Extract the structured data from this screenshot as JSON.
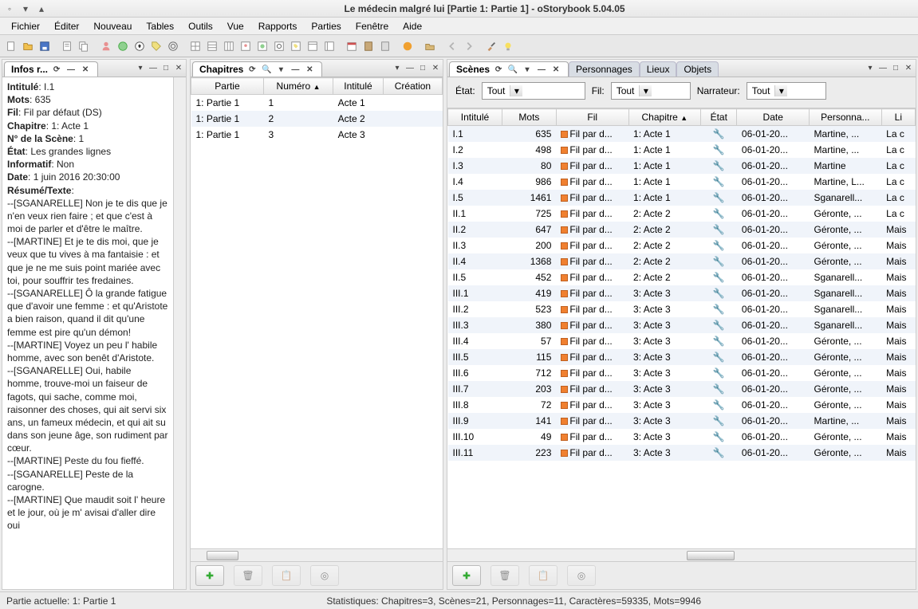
{
  "window": {
    "title": "Le médecin malgré lui [Partie 1: Partie 1] - oStorybook 5.04.05"
  },
  "menubar": [
    "Fichier",
    "Éditer",
    "Nouveau",
    "Tables",
    "Outils",
    "Vue",
    "Rapports",
    "Parties",
    "Fenêtre",
    "Aide"
  ],
  "panels": {
    "infos": {
      "tab": "Infos r...",
      "fields": {
        "intitule_label": "Intitulé",
        "intitule_value": "I.1",
        "mots_label": "Mots",
        "mots_value": "635",
        "fil_label": "Fil",
        "fil_value": "Fil par défaut (DS)",
        "chapitre_label": "Chapitre",
        "chapitre_value": "1: Acte 1",
        "numscene_label": "N° de la Scène",
        "numscene_value": "1",
        "etat_label": "État",
        "etat_value": "Les grandes lignes",
        "informatif_label": "Informatif",
        "informatif_value": "Non",
        "date_label": "Date",
        "date_value": "1 juin 2016 20:30:00",
        "resume_label": "Résumé/Texte"
      },
      "resume": "--[SGANARELLE] Non je te dis que je n'en veux rien faire ; et que c'est à moi de parler et d'être le maître.\n--[MARTINE] Et je te dis moi, que je veux que tu vives à ma fantaisie : et que je ne me suis point mariée avec toi, pour souffrir tes fredaines.\n--[SGANARELLE] Ô la grande fatigue que d'avoir une femme : et qu'Aristote a bien raison, quand il dit qu'une femme est pire qu'un démon!\n--[MARTINE] Voyez un peu l' habile homme, avec son benêt d'Aristote.\n--[SGANARELLE] Oui, habile homme, trouve-moi un faiseur de fagots, qui sache, comme moi, raisonner des choses, qui ait servi six ans, un fameux médecin, et qui ait su dans son jeune âge, son rudiment par cœur.\n--[MARTINE] Peste du fou fieffé.\n--[SGANARELLE] Peste de la carogne.\n--[MARTINE] Que maudit soit l' heure et le jour, où je m' avisai d'aller dire oui"
    },
    "chapitres": {
      "tab": "Chapitres",
      "columns": [
        "Partie",
        "Numéro",
        "Intitulé",
        "Création"
      ],
      "rows": [
        {
          "partie": "1: Partie 1",
          "numero": "1",
          "intitule": "Acte 1",
          "creation": ""
        },
        {
          "partie": "1: Partie 1",
          "numero": "2",
          "intitule": "Acte 2",
          "creation": ""
        },
        {
          "partie": "1: Partie 1",
          "numero": "3",
          "intitule": "Acte 3",
          "creation": ""
        }
      ]
    },
    "scenes": {
      "tab": "Scènes",
      "other_tabs": [
        "Personnages",
        "Lieux",
        "Objets"
      ],
      "filters": {
        "etat_label": "État:",
        "etat_value": "Tout",
        "fil_label": "Fil:",
        "fil_value": "Tout",
        "narr_label": "Narrateur:",
        "narr_value": "Tout"
      },
      "columns": [
        "Intitulé",
        "Mots",
        "Fil",
        "Chapitre",
        "État",
        "Date",
        "Personna...",
        "Li"
      ],
      "rows": [
        {
          "intitule": "I.1",
          "mots": "635",
          "fil": "Fil par d...",
          "chapitre": "1: Acte 1",
          "date": "06-01-20...",
          "pers": "Martine, ...",
          "li": "La c"
        },
        {
          "intitule": "I.2",
          "mots": "498",
          "fil": "Fil par d...",
          "chapitre": "1: Acte 1",
          "date": "06-01-20...",
          "pers": "Martine, ...",
          "li": "La c"
        },
        {
          "intitule": "I.3",
          "mots": "80",
          "fil": "Fil par d...",
          "chapitre": "1: Acte 1",
          "date": "06-01-20...",
          "pers": "Martine",
          "li": "La c"
        },
        {
          "intitule": "I.4",
          "mots": "986",
          "fil": "Fil par d...",
          "chapitre": "1: Acte 1",
          "date": "06-01-20...",
          "pers": "Martine, L...",
          "li": "La c"
        },
        {
          "intitule": "I.5",
          "mots": "1461",
          "fil": "Fil par d...",
          "chapitre": "1: Acte 1",
          "date": "06-01-20...",
          "pers": "Sganarell...",
          "li": "La c"
        },
        {
          "intitule": "II.1",
          "mots": "725",
          "fil": "Fil par d...",
          "chapitre": "2: Acte 2",
          "date": "06-01-20...",
          "pers": "Géronte, ...",
          "li": "La c"
        },
        {
          "intitule": "II.2",
          "mots": "647",
          "fil": "Fil par d...",
          "chapitre": "2: Acte 2",
          "date": "06-01-20...",
          "pers": "Géronte, ...",
          "li": "Mais"
        },
        {
          "intitule": "II.3",
          "mots": "200",
          "fil": "Fil par d...",
          "chapitre": "2: Acte 2",
          "date": "06-01-20...",
          "pers": "Géronte, ...",
          "li": "Mais"
        },
        {
          "intitule": "II.4",
          "mots": "1368",
          "fil": "Fil par d...",
          "chapitre": "2: Acte 2",
          "date": "06-01-20...",
          "pers": "Géronte, ...",
          "li": "Mais"
        },
        {
          "intitule": "II.5",
          "mots": "452",
          "fil": "Fil par d...",
          "chapitre": "2: Acte 2",
          "date": "06-01-20...",
          "pers": "Sganarell...",
          "li": "Mais"
        },
        {
          "intitule": "III.1",
          "mots": "419",
          "fil": "Fil par d...",
          "chapitre": "3: Acte 3",
          "date": "06-01-20...",
          "pers": "Sganarell...",
          "li": "Mais"
        },
        {
          "intitule": "III.2",
          "mots": "523",
          "fil": "Fil par d...",
          "chapitre": "3: Acte 3",
          "date": "06-01-20...",
          "pers": "Sganarell...",
          "li": "Mais"
        },
        {
          "intitule": "III.3",
          "mots": "380",
          "fil": "Fil par d...",
          "chapitre": "3: Acte 3",
          "date": "06-01-20...",
          "pers": "Sganarell...",
          "li": "Mais"
        },
        {
          "intitule": "III.4",
          "mots": "57",
          "fil": "Fil par d...",
          "chapitre": "3: Acte 3",
          "date": "06-01-20...",
          "pers": "Géronte, ...",
          "li": "Mais"
        },
        {
          "intitule": "III.5",
          "mots": "115",
          "fil": "Fil par d...",
          "chapitre": "3: Acte 3",
          "date": "06-01-20...",
          "pers": "Géronte, ...",
          "li": "Mais"
        },
        {
          "intitule": "III.6",
          "mots": "712",
          "fil": "Fil par d...",
          "chapitre": "3: Acte 3",
          "date": "06-01-20...",
          "pers": "Géronte, ...",
          "li": "Mais"
        },
        {
          "intitule": "III.7",
          "mots": "203",
          "fil": "Fil par d...",
          "chapitre": "3: Acte 3",
          "date": "06-01-20...",
          "pers": "Géronte, ...",
          "li": "Mais"
        },
        {
          "intitule": "III.8",
          "mots": "72",
          "fil": "Fil par d...",
          "chapitre": "3: Acte 3",
          "date": "06-01-20...",
          "pers": "Géronte, ...",
          "li": "Mais"
        },
        {
          "intitule": "III.9",
          "mots": "141",
          "fil": "Fil par d...",
          "chapitre": "3: Acte 3",
          "date": "06-01-20...",
          "pers": "Martine, ...",
          "li": "Mais"
        },
        {
          "intitule": "III.10",
          "mots": "49",
          "fil": "Fil par d...",
          "chapitre": "3: Acte 3",
          "date": "06-01-20...",
          "pers": "Géronte, ...",
          "li": "Mais"
        },
        {
          "intitule": "III.11",
          "mots": "223",
          "fil": "Fil par d...",
          "chapitre": "3: Acte 3",
          "date": "06-01-20...",
          "pers": "Géronte, ...",
          "li": "Mais"
        }
      ]
    }
  },
  "statusbar": {
    "partie": "Partie actuelle: 1: Partie 1",
    "stats": "Statistiques: Chapitres=3,  Scènes=21,  Personnages=11,  Caractères=59335,  Mots=9946"
  }
}
